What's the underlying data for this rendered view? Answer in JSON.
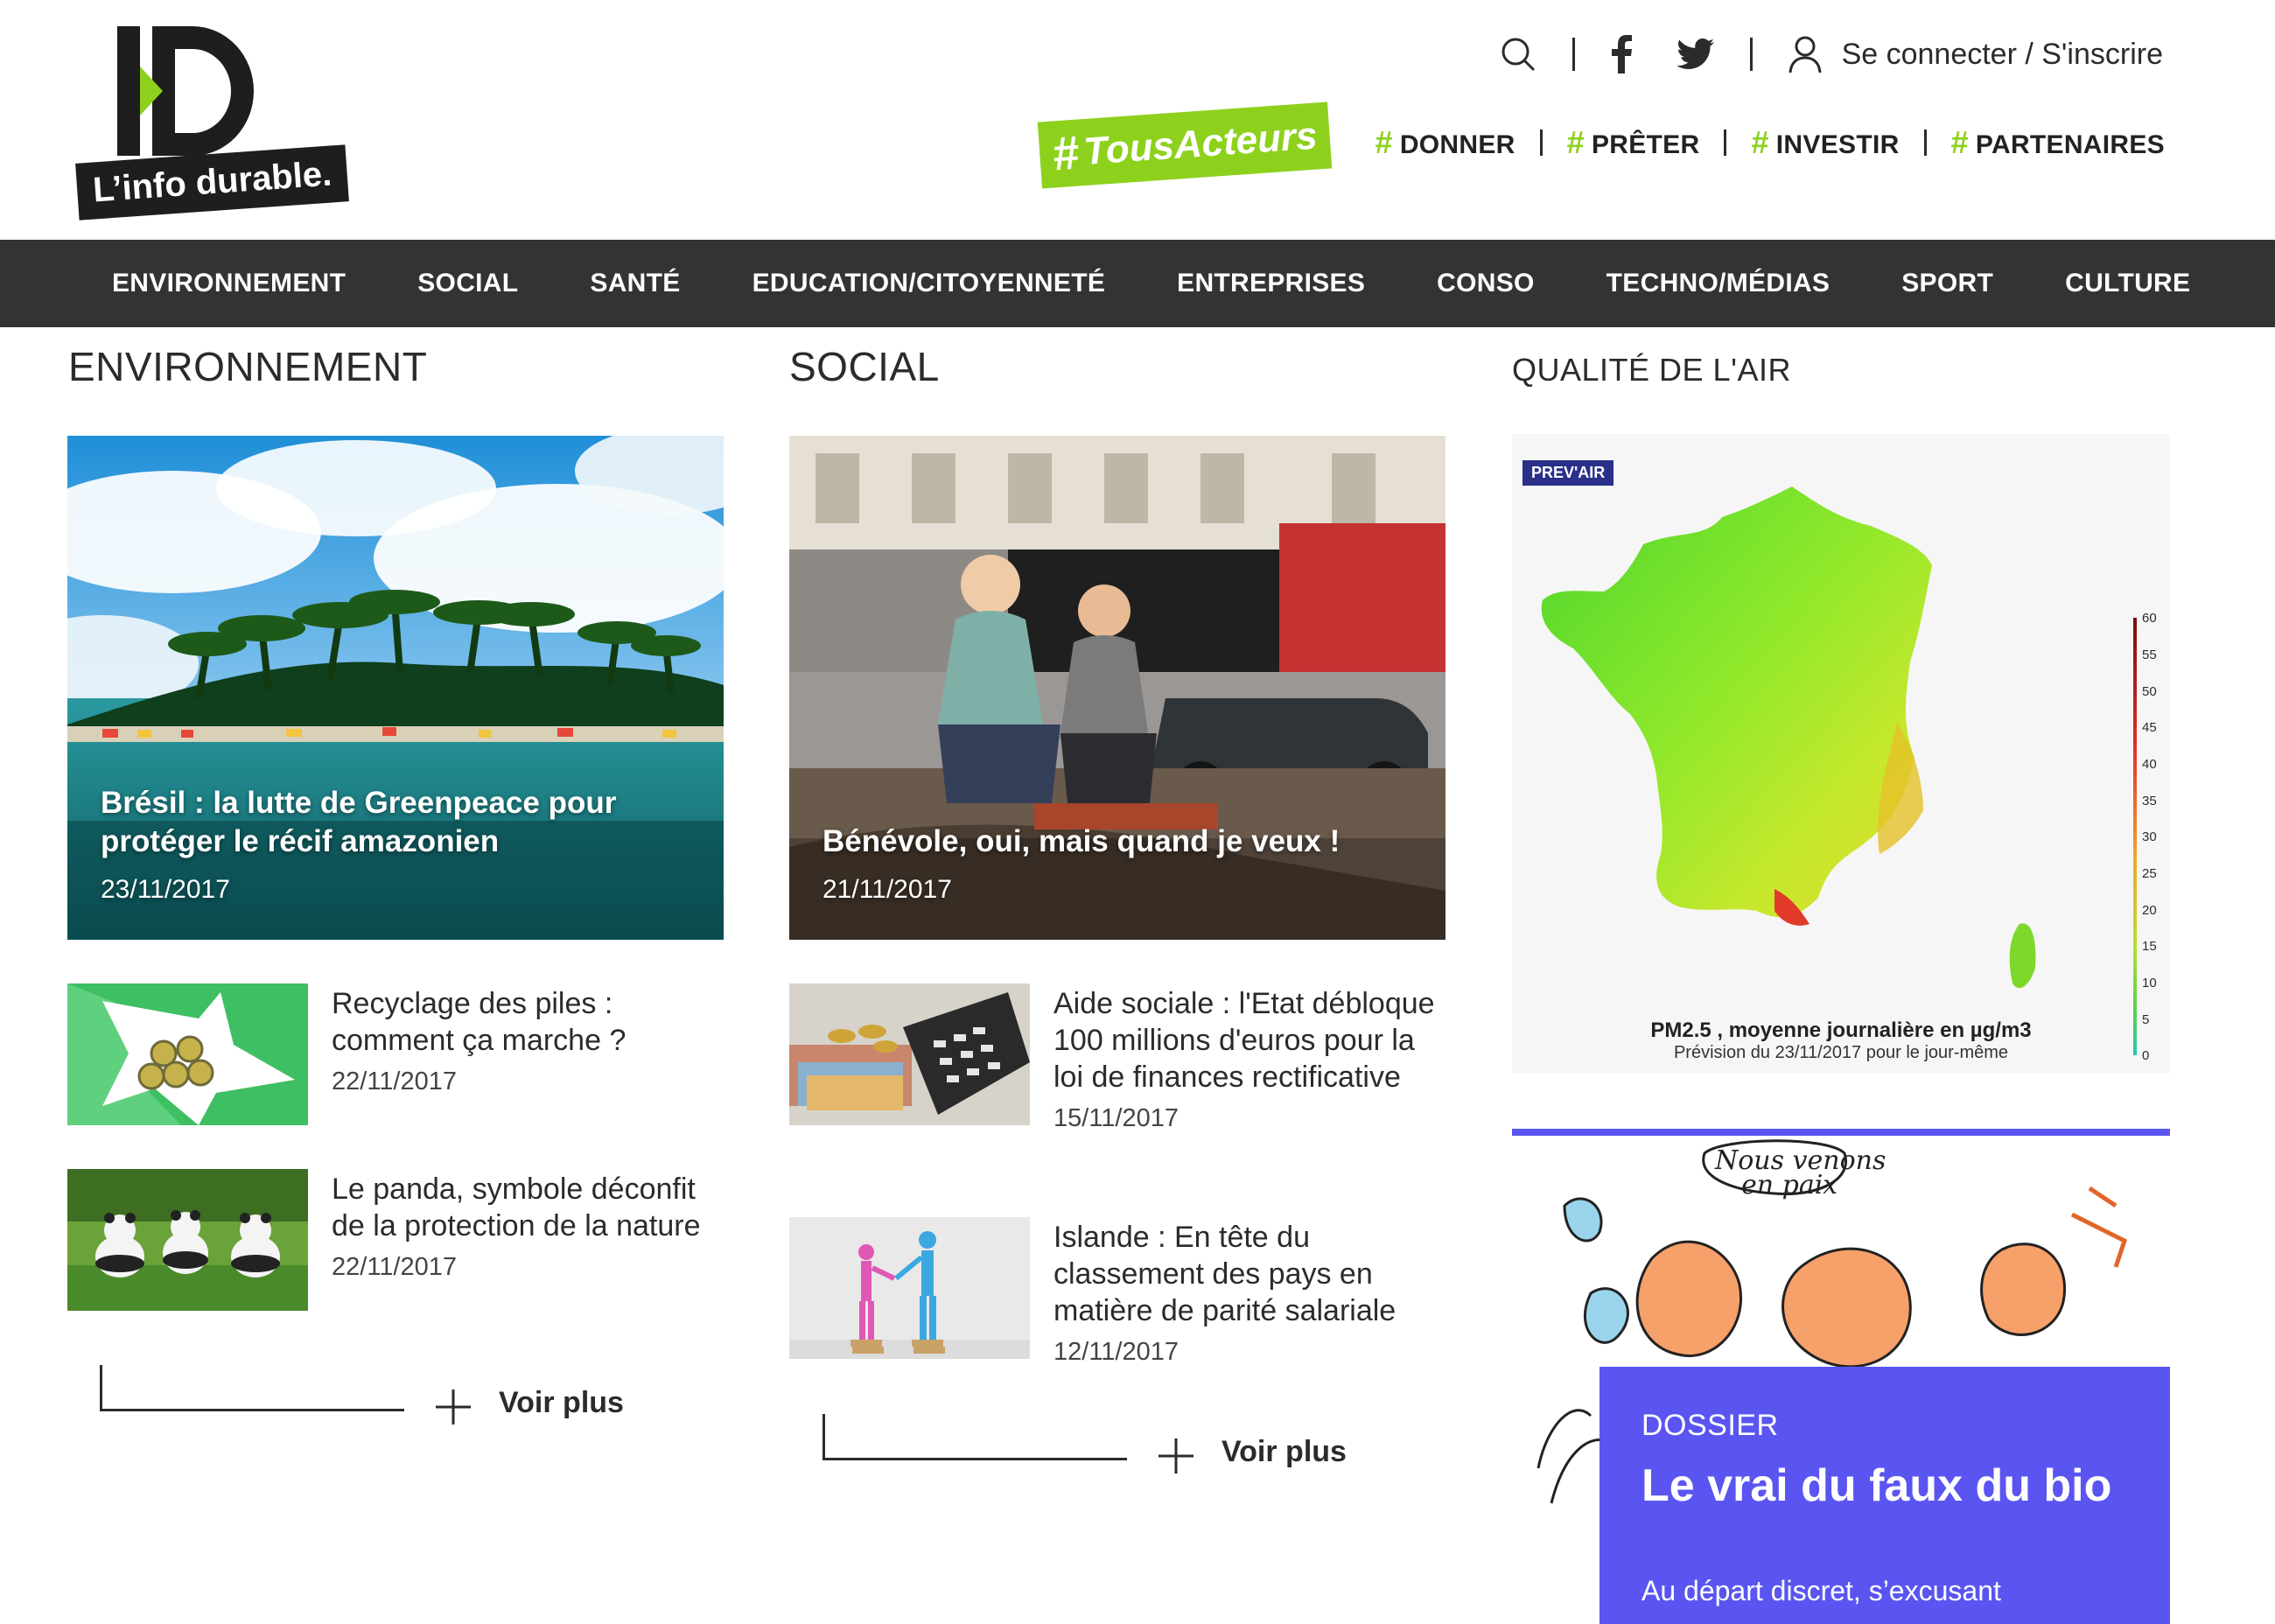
{
  "header": {
    "logo_text": "L’info durable.",
    "login_label": "Se connecter / S'inscrire",
    "campaign_label": "TousActeurs",
    "campaign_hash": "#",
    "actions": [
      {
        "hash": "#",
        "label": "DONNER"
      },
      {
        "hash": "#",
        "label": "PRÊTER"
      },
      {
        "hash": "#",
        "label": "INVESTIR"
      },
      {
        "hash": "#",
        "label": "PARTENAIRES"
      }
    ]
  },
  "nav": {
    "items": [
      "ENVIRONNEMENT",
      "SOCIAL",
      "SANTÉ",
      "EDUCATION/CITOYENNETÉ",
      "ENTREPRISES",
      "CONSO",
      "TECHNO/MÉDIAS",
      "SPORT",
      "CULTURE"
    ]
  },
  "sections": {
    "env": {
      "title": "ENVIRONNEMENT",
      "feature": {
        "title": "Brésil : la lutte de Greenpeace pour protéger le récif amazonien",
        "date": "23/11/2017"
      },
      "articles": [
        {
          "title": "Recyclage des piles : comment ça marche ?",
          "date": "22/11/2017"
        },
        {
          "title": "Le panda, symbole déconfit de la protection de la nature",
          "date": "22/11/2017"
        }
      ],
      "more_label": "Voir plus"
    },
    "social": {
      "title": "SOCIAL",
      "feature": {
        "title": "Bénévole, oui, mais quand je veux !",
        "date": "21/11/2017"
      },
      "articles": [
        {
          "title": "Aide sociale : l'Etat débloque 100 millions d'euros pour la loi de finances rectificative",
          "date": "15/11/2017"
        },
        {
          "title": "Islande : En tête du classement des pays en matière de parité salariale",
          "date": "12/11/2017"
        }
      ],
      "more_label": "Voir plus"
    },
    "air": {
      "title": "QUALITÉ DE L'AIR",
      "badge": "PREV'AIR",
      "caption": "PM2.5 , moyenne journalière en µg/m3",
      "subcaption": "Prévision du 23/11/2017 pour le jour-même",
      "scale_labels": [
        "60",
        "55",
        "50",
        "45",
        "40",
        "35",
        "30",
        "25",
        "20",
        "15",
        "10",
        "5",
        "0"
      ]
    },
    "dossier": {
      "kicker": "DOSSIER",
      "title": "Le vrai du faux du bio",
      "teaser": "Au départ discret, s’excusant",
      "cartoon_text": "Nous venons en paix"
    }
  },
  "colors": {
    "accent_green": "#8dd11d",
    "nav_bg": "#333333",
    "dossier_blue": "#5a55f0"
  },
  "icons": [
    "search-icon",
    "facebook-icon",
    "twitter-icon",
    "user-icon",
    "plus-icon"
  ]
}
